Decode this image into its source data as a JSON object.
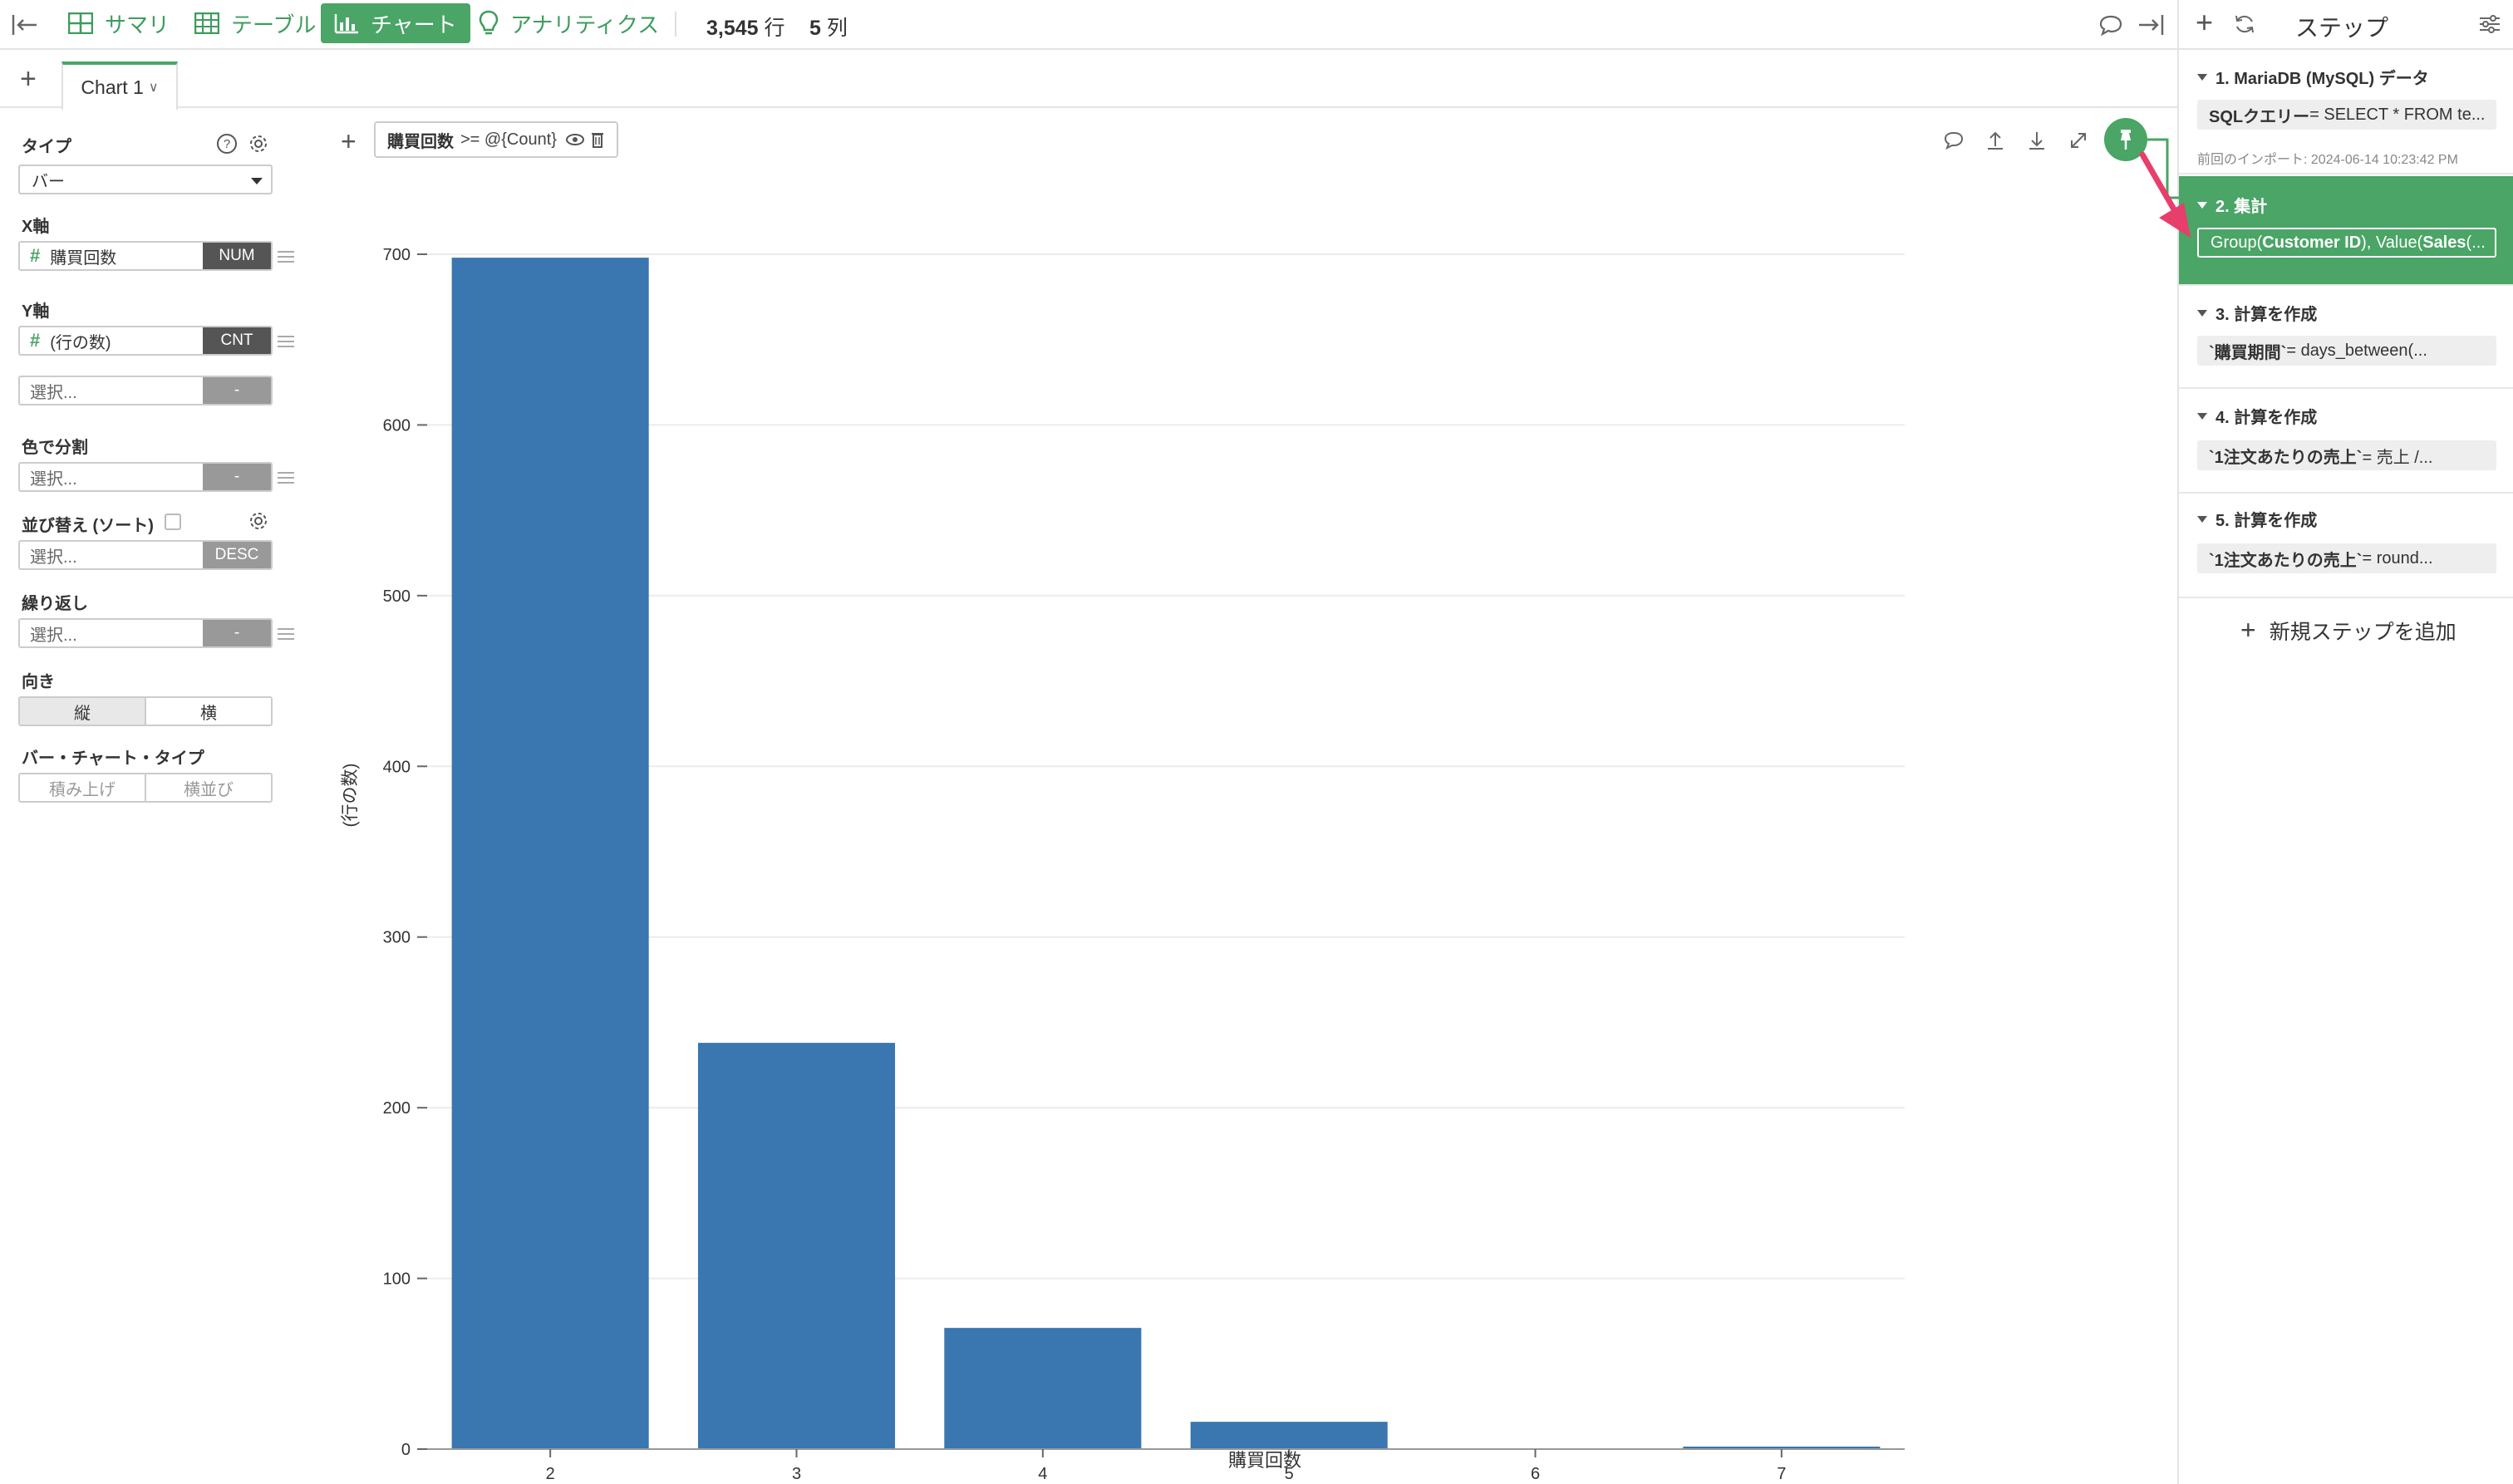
{
  "toolbar": {
    "tabs": [
      {
        "label": "サマリ",
        "icon": "summary-grid-icon"
      },
      {
        "label": "テーブル",
        "icon": "table-icon"
      },
      {
        "label": "チャート",
        "icon": "bar-chart-icon"
      },
      {
        "label": "アナリティクス",
        "icon": "lightbulb-icon"
      }
    ],
    "active_tab": "チャート",
    "rows": "3,545",
    "rows_unit": "行",
    "cols": "5",
    "cols_unit": "列",
    "accent_color": "#4aa566"
  },
  "chart_tabs": {
    "add_label": "+",
    "tabs": [
      {
        "label": "Chart 1"
      }
    ]
  },
  "config": {
    "type": {
      "label": "タイプ",
      "value": "バー"
    },
    "x_axis": {
      "label": "X軸",
      "field": "購買回数",
      "tag": "NUM"
    },
    "y_axis": {
      "label": "Y軸",
      "field": "(行の数)",
      "tag": "CNT",
      "extra_placeholder": "選択...",
      "extra_tag": "-"
    },
    "color": {
      "label": "色で分割",
      "placeholder": "選択...",
      "tag": "-"
    },
    "sort": {
      "label": "並び替え (ソート)",
      "placeholder": "選択...",
      "tag": "DESC"
    },
    "repeat": {
      "label": "繰り返し",
      "placeholder": "選択...",
      "tag": "-"
    },
    "orientation": {
      "label": "向き",
      "options": [
        "縦",
        "横"
      ],
      "selected": "縦"
    },
    "bar_type": {
      "label": "バー・チャート・タイプ",
      "options": [
        "積み上げ",
        "横並び"
      ]
    }
  },
  "filter": {
    "field": "購買回数",
    "expression": ">= @{Count}"
  },
  "chart_data": {
    "type": "bar",
    "categories": [
      "2",
      "3",
      "4",
      "5",
      "6",
      "7"
    ],
    "values": [
      698,
      238,
      71,
      16,
      0,
      1
    ],
    "xlabel": "購買回数",
    "ylabel": "(行の数)",
    "ylim": [
      0,
      700
    ],
    "yticks": [
      0,
      100,
      200,
      300,
      400,
      500,
      600,
      700
    ],
    "bar_color": "#3a76af",
    "grid": true
  },
  "steps_panel": {
    "title": "ステップ",
    "steps": [
      {
        "title": "1. MariaDB (MySQL) データ",
        "box_key": "SQLクエリー",
        "box_rest": " = SELECT * FROM te...",
        "meta": "前回のインポート: 2024-06-14 10:23:42 PM"
      },
      {
        "title": "2. 集計",
        "box_html_parts": [
          "Group(",
          "Customer ID",
          "), Value(",
          "Sales",
          " (..."
        ],
        "active": true
      },
      {
        "title": "3. 計算を作成",
        "box_key": "`購買期間`",
        "box_rest": " = days_between(..."
      },
      {
        "title": "4. 計算を作成",
        "box_key": "`1注文あたりの売上`",
        "box_rest": " = 売上 /..."
      },
      {
        "title": "5. 計算を作成",
        "box_key": "`1注文あたりの売上`",
        "box_rest": " = round..."
      }
    ],
    "add_step_label": "新規ステップを追加"
  }
}
